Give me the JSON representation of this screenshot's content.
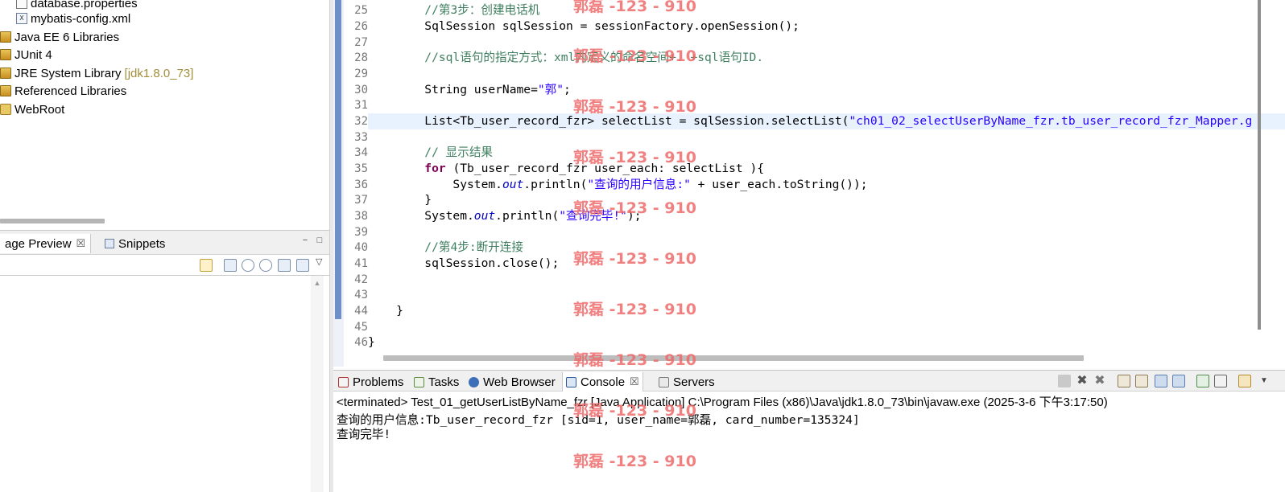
{
  "package_explorer": {
    "items": [
      {
        "label": "database.properties",
        "icon": "properties-file-icon"
      },
      {
        "label": "mybatis-config.xml",
        "icon": "xml-file-icon"
      },
      {
        "label": "Java EE 6 Libraries",
        "icon": "library-icon"
      },
      {
        "label": "JUnit 4",
        "icon": "library-icon"
      },
      {
        "label": "JRE System Library",
        "decoration": "[jdk1.8.0_73]",
        "icon": "library-icon"
      },
      {
        "label": "Referenced Libraries",
        "icon": "library-icon"
      },
      {
        "label": "WebRoot",
        "icon": "folder-icon"
      }
    ]
  },
  "lower_left": {
    "tabs": [
      {
        "label": "age Preview",
        "icon": "preview-icon",
        "close": "☒"
      },
      {
        "label": "Snippets",
        "icon": "snippets-icon"
      }
    ],
    "minimize": "−",
    "maximize": "□",
    "menu": "▽",
    "scroll_up": "▲"
  },
  "editor": {
    "lines": [
      {
        "num": "25",
        "text": "        //第3步：创建电话机"
      },
      {
        "num": "26",
        "text": "        SqlSession sqlSession = sessionFactory.openSession();"
      },
      {
        "num": "27",
        "text": ""
      },
      {
        "num": "28",
        "text": "        //sql语句的指定方式：xml内定义的命名空间+. +sql语句ID."
      },
      {
        "num": "29",
        "text": ""
      },
      {
        "num": "30",
        "pre": "        String userName=",
        "str": "\"郭\"",
        "post": ";"
      },
      {
        "num": "31",
        "text": ""
      },
      {
        "num": "32",
        "pre": "        List<Tb_user_record_fzr> selectList = sqlSession.selectList(",
        "str": "\"ch01_02_selectUserByName_fzr.tb_user_record_fzr_Mapper.g",
        "post": ""
      },
      {
        "num": "33",
        "text": ""
      },
      {
        "num": "34",
        "text": "        // 显示结果"
      },
      {
        "num": "35",
        "kw": "        for",
        "post": " (Tb_user_record_fzr user_each: selectList ){"
      },
      {
        "num": "36",
        "pre": "            System.",
        "fld": "out",
        "mid": ".println(",
        "str": "\"查询的用户信息:\"",
        "post": " + user_each.toString());"
      },
      {
        "num": "37",
        "text": "        }"
      },
      {
        "num": "38",
        "pre": "        System.",
        "fld": "out",
        "mid": ".println(",
        "str": "\"查询完毕!\"",
        "post": ");"
      },
      {
        "num": "39",
        "text": ""
      },
      {
        "num": "40",
        "text": "        //第4步:断开连接"
      },
      {
        "num": "41",
        "text": "        sqlSession.close();"
      },
      {
        "num": "42",
        "text": ""
      },
      {
        "num": "43",
        "text": ""
      },
      {
        "num": "44",
        "text": "    }"
      },
      {
        "num": "45",
        "text": ""
      },
      {
        "num": "46",
        "text": "}"
      }
    ]
  },
  "console": {
    "tabs": [
      {
        "label": "Problems",
        "icon": "problems-icon"
      },
      {
        "label": "Tasks",
        "icon": "tasks-icon"
      },
      {
        "label": "Web Browser",
        "icon": "web-browser-icon"
      },
      {
        "label": "Console",
        "icon": "console-icon",
        "close": "☒"
      },
      {
        "label": "Servers",
        "icon": "servers-icon"
      }
    ],
    "header": "<terminated> Test_01_getUserListByName_fzr [Java Application] C:\\Program Files (x86)\\Java\\jdk1.8.0_73\\bin\\javaw.exe (2025-3-6 下午3:17:50)",
    "output": [
      "查询的用户信息:Tb_user_record_fzr [sid=1, user_name=郭磊, card_number=135324]",
      "查询完毕!"
    ]
  },
  "watermark": "郭磊 -123 - 910",
  "colors": {
    "comment": "#3f7f5f",
    "keyword": "#7f0055",
    "string": "#2a00ff",
    "static_field": "#0000c0",
    "watermark": "#ef6b6b",
    "highlight_line": "#e8f2fe"
  }
}
